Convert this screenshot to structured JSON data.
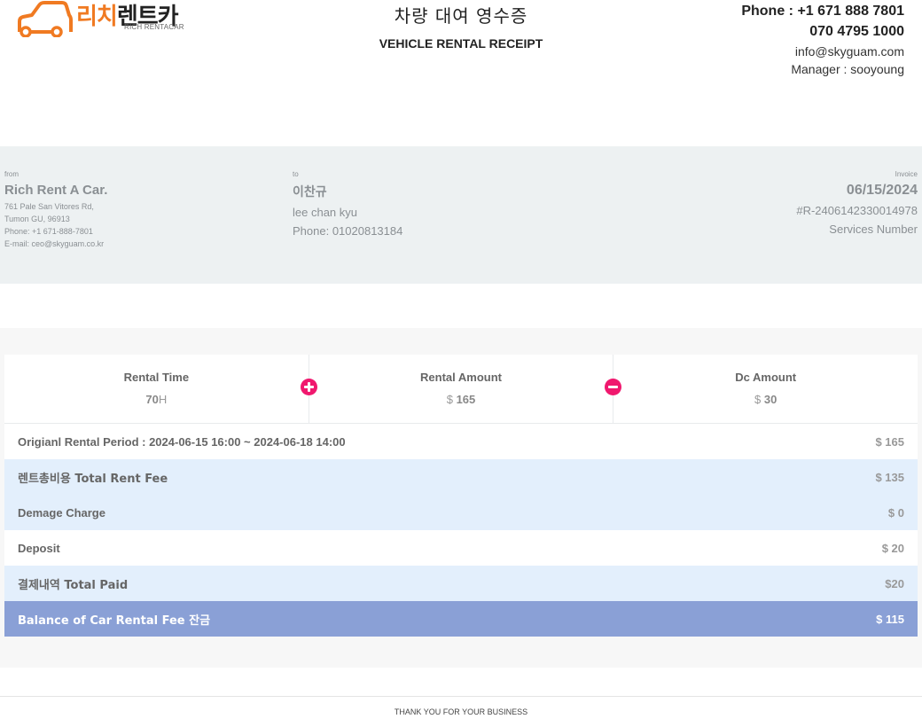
{
  "brand": {
    "name_ko_part1": "리치",
    "name_ko_part2": "렌트카",
    "name_en": "RICH RENTACAR",
    "accent_color": "#f07a22"
  },
  "title": {
    "korean": "차량 대여 영수증",
    "english": "VEHICLE RENTAL RECEIPT"
  },
  "contact": {
    "phone": "Phone : +1 671 888 7801",
    "phone2": "070 4795 1000",
    "email": "info@skyguam.com",
    "manager": "Manager : sooyoung"
  },
  "from": {
    "label": "from",
    "name": "Rich Rent A Car.",
    "address1": "761 Pale San Vitores Rd,",
    "address2": "Tumon GU, 96913",
    "phone": "Phone: +1 671-888-7801",
    "email": "E-mail: ceo@skyguam.co.kr"
  },
  "to": {
    "label": "to",
    "name_ko": "이찬규",
    "name_en": "lee chan kyu",
    "phone": "Phone: 01020813184"
  },
  "invoice": {
    "label": "Invoice",
    "date": "06/15/2024",
    "number": "#R-2406142330014978",
    "services_label": "Services Number"
  },
  "summary": {
    "rental_time": {
      "label": "Rental Time",
      "value": "70",
      "unit": "H"
    },
    "rental_amount": {
      "label": "Rental Amount",
      "currency": "$",
      "value": "165"
    },
    "dc_amount": {
      "label": "Dc Amount",
      "currency": "$",
      "value": "30"
    },
    "plus_icon": "plus-circle-icon",
    "minus_icon": "minus-circle-icon",
    "op_color": "#f0186e"
  },
  "rows": [
    {
      "label": "Origianl Rental Period : 2024-06-15 16:00 ~ 2024-06-18 14:00",
      "amount": "$ 165"
    },
    {
      "label": "렌트총비용 Total Rent Fee",
      "amount": "$ 135"
    },
    {
      "label": "Demage Charge",
      "amount": "$ 0"
    },
    {
      "label": "Deposit",
      "amount": "$ 20"
    },
    {
      "label": "결제내역 Total Paid",
      "amount": "$20"
    },
    {
      "label": "Balance of Car Rental Fee 잔금",
      "amount": "$ 115"
    }
  ],
  "footer": {
    "text": "THANK YOU FOR YOUR BUSINESS"
  }
}
